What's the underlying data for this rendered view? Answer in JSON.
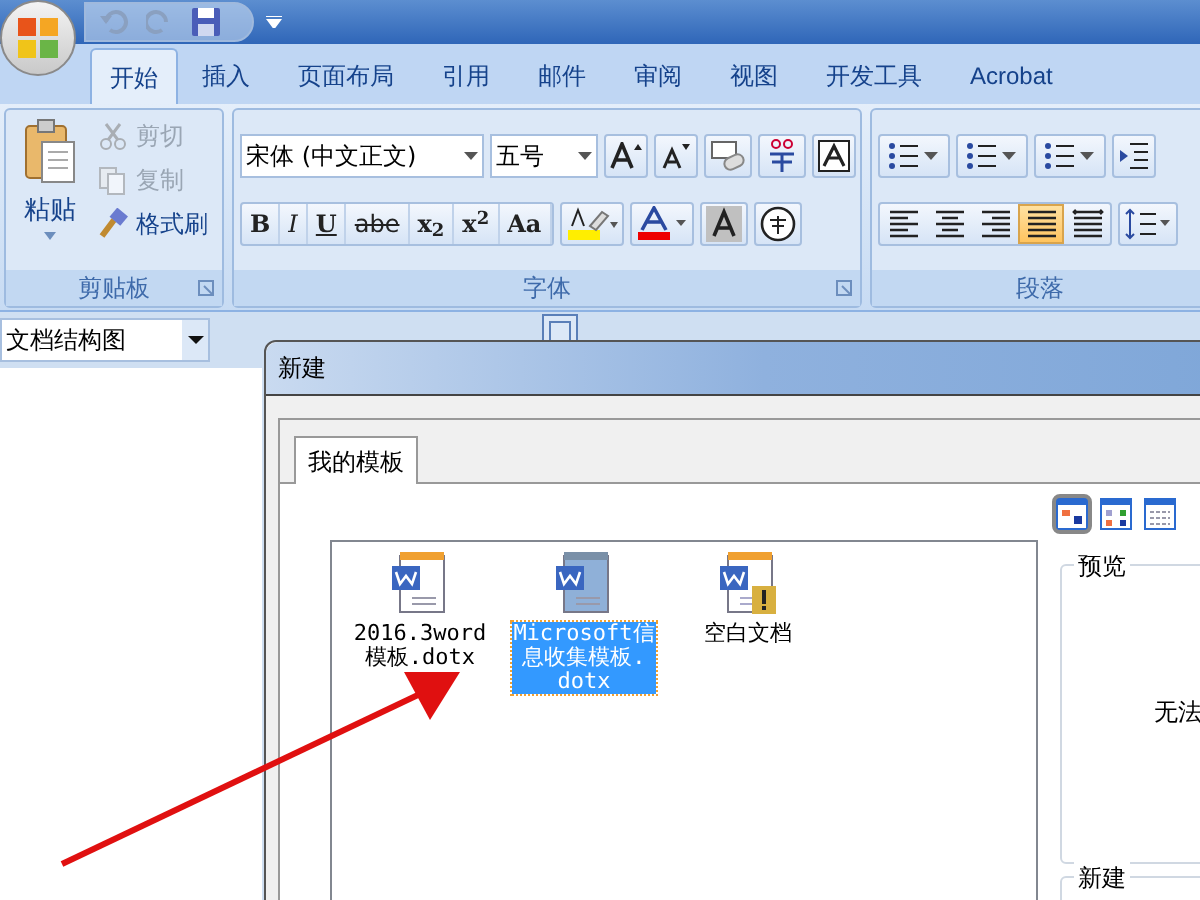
{
  "ribbon_tabs": [
    {
      "label": "开始",
      "selected": true
    },
    {
      "label": "插入",
      "selected": false
    },
    {
      "label": "页面布局",
      "selected": false
    },
    {
      "label": "引用",
      "selected": false
    },
    {
      "label": "邮件",
      "selected": false
    },
    {
      "label": "审阅",
      "selected": false
    },
    {
      "label": "视图",
      "selected": false
    },
    {
      "label": "开发工具",
      "selected": false
    },
    {
      "label": "Acrobat",
      "selected": false
    }
  ],
  "clipboard": {
    "label": "剪贴板",
    "paste": "粘贴",
    "items": [
      {
        "label": "剪切",
        "disabled": true
      },
      {
        "label": "复制",
        "disabled": true
      },
      {
        "label": "格式刷",
        "disabled": false
      }
    ]
  },
  "font": {
    "label": "字体",
    "font_name": "宋体 (中文正文)",
    "font_size": "五号",
    "buttons": [
      {
        "label": "B",
        "kind": "bold"
      },
      {
        "label": "I",
        "kind": "italic"
      },
      {
        "label": "U",
        "kind": "underline"
      },
      {
        "label": "abe",
        "kind": "strike"
      },
      {
        "label": "x$_{2}$",
        "kind": "plain"
      },
      {
        "label": "x$^{2}$",
        "kind": "plain"
      },
      {
        "label": "Aa",
        "kind": "plain"
      }
    ]
  },
  "paragraph": {
    "label": "段落",
    "alignment": [
      {
        "kind": "left",
        "selected": false
      },
      {
        "kind": "center",
        "selected": false
      },
      {
        "kind": "right",
        "selected": false
      },
      {
        "kind": "justify",
        "selected": true
      },
      {
        "kind": "distributed",
        "selected": false
      }
    ]
  },
  "document_map": {
    "value": "文档结构图"
  },
  "dialog": {
    "title": "新建",
    "tab": "我的模板",
    "templates": [
      {
        "lines": [
          "2016.3word",
          "模板.dotx"
        ],
        "kind": "template",
        "selected": false
      },
      {
        "lines": [
          "Microsoft信",
          "息收集模板.",
          "dotx"
        ],
        "kind": "template",
        "selected": true
      },
      {
        "lines": [
          "空白文档"
        ],
        "kind": "blank",
        "selected": false
      }
    ],
    "preview_label": "预览",
    "preview_text": "无法",
    "new_label": "新建"
  }
}
